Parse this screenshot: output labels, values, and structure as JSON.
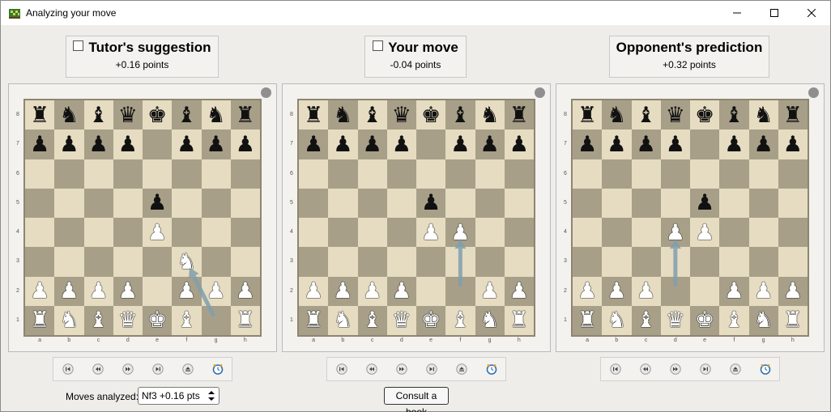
{
  "window": {
    "title": "Analyzing your move",
    "icon": "chess-board-app-icon",
    "controls": [
      "minimize-icon",
      "maximize-icon",
      "close-icon"
    ]
  },
  "panels": [
    {
      "title": "Tutor's suggestion",
      "points": "+0.16 points",
      "checked": false,
      "arrow": {
        "from": "g1",
        "to": "f3"
      },
      "position": [
        [
          "r",
          "n",
          "b",
          "q",
          "k",
          "b",
          "n",
          "r"
        ],
        [
          "p",
          "p",
          "p",
          "p",
          "",
          "p",
          "p",
          "p"
        ],
        [
          "",
          "",
          "",
          "",
          "",
          "",
          "",
          ""
        ],
        [
          "",
          "",
          "",
          "",
          "p",
          "",
          "",
          ""
        ],
        [
          "",
          "",
          "",
          "",
          "P",
          "",
          "",
          ""
        ],
        [
          "",
          "",
          "",
          "",
          "",
          "N",
          "",
          ""
        ],
        [
          "P",
          "P",
          "P",
          "P",
          "",
          "P",
          "P",
          "P"
        ],
        [
          "R",
          "N",
          "B",
          "Q",
          "K",
          "B",
          "",
          "R"
        ]
      ]
    },
    {
      "title": "Your move",
      "points": "-0.04 points",
      "checked": false,
      "arrow": {
        "from": "f2",
        "to": "f4"
      },
      "position": [
        [
          "r",
          "n",
          "b",
          "q",
          "k",
          "b",
          "n",
          "r"
        ],
        [
          "p",
          "p",
          "p",
          "p",
          "",
          "p",
          "p",
          "p"
        ],
        [
          "",
          "",
          "",
          "",
          "",
          "",
          "",
          ""
        ],
        [
          "",
          "",
          "",
          "",
          "p",
          "",
          "",
          ""
        ],
        [
          "",
          "",
          "",
          "",
          "P",
          "P",
          "",
          ""
        ],
        [
          "",
          "",
          "",
          "",
          "",
          "",
          "",
          ""
        ],
        [
          "P",
          "P",
          "P",
          "P",
          "",
          "",
          "P",
          "P"
        ],
        [
          "R",
          "N",
          "B",
          "Q",
          "K",
          "B",
          "N",
          "R"
        ]
      ]
    },
    {
      "title": "Opponent's prediction",
      "points": "+0.32 points",
      "checked": false,
      "arrow": {
        "from": "d2",
        "to": "d4"
      },
      "position": [
        [
          "r",
          "n",
          "b",
          "q",
          "k",
          "b",
          "n",
          "r"
        ],
        [
          "p",
          "p",
          "p",
          "p",
          "",
          "p",
          "p",
          "p"
        ],
        [
          "",
          "",
          "",
          "",
          "",
          "",
          "",
          ""
        ],
        [
          "",
          "",
          "",
          "",
          "p",
          "",
          "",
          ""
        ],
        [
          "",
          "",
          "",
          "P",
          "P",
          "",
          "",
          ""
        ],
        [
          "",
          "",
          "",
          "",
          "",
          "",
          "",
          ""
        ],
        [
          "P",
          "P",
          "P",
          "",
          "",
          "P",
          "P",
          "P"
        ],
        [
          "R",
          "N",
          "B",
          "Q",
          "K",
          "B",
          "N",
          "R"
        ]
      ]
    }
  ],
  "ranks": [
    "8",
    "7",
    "6",
    "5",
    "4",
    "3",
    "2",
    "1"
  ],
  "files": [
    "a",
    "b",
    "c",
    "d",
    "e",
    "f",
    "g",
    "h"
  ],
  "nav_buttons": [
    "first-move-icon",
    "previous-move-icon",
    "next-move-icon",
    "last-move-icon",
    "eject-icon",
    "clock-icon"
  ],
  "footer": {
    "moves_label": "Moves analyzed:",
    "moves_value": "Nf3 +0.16 pts",
    "book_button": "Consult a book"
  },
  "colors": {
    "light_square": "#e6dcc1",
    "dark_square": "#a89f88",
    "arrow": "#7f9fad"
  }
}
